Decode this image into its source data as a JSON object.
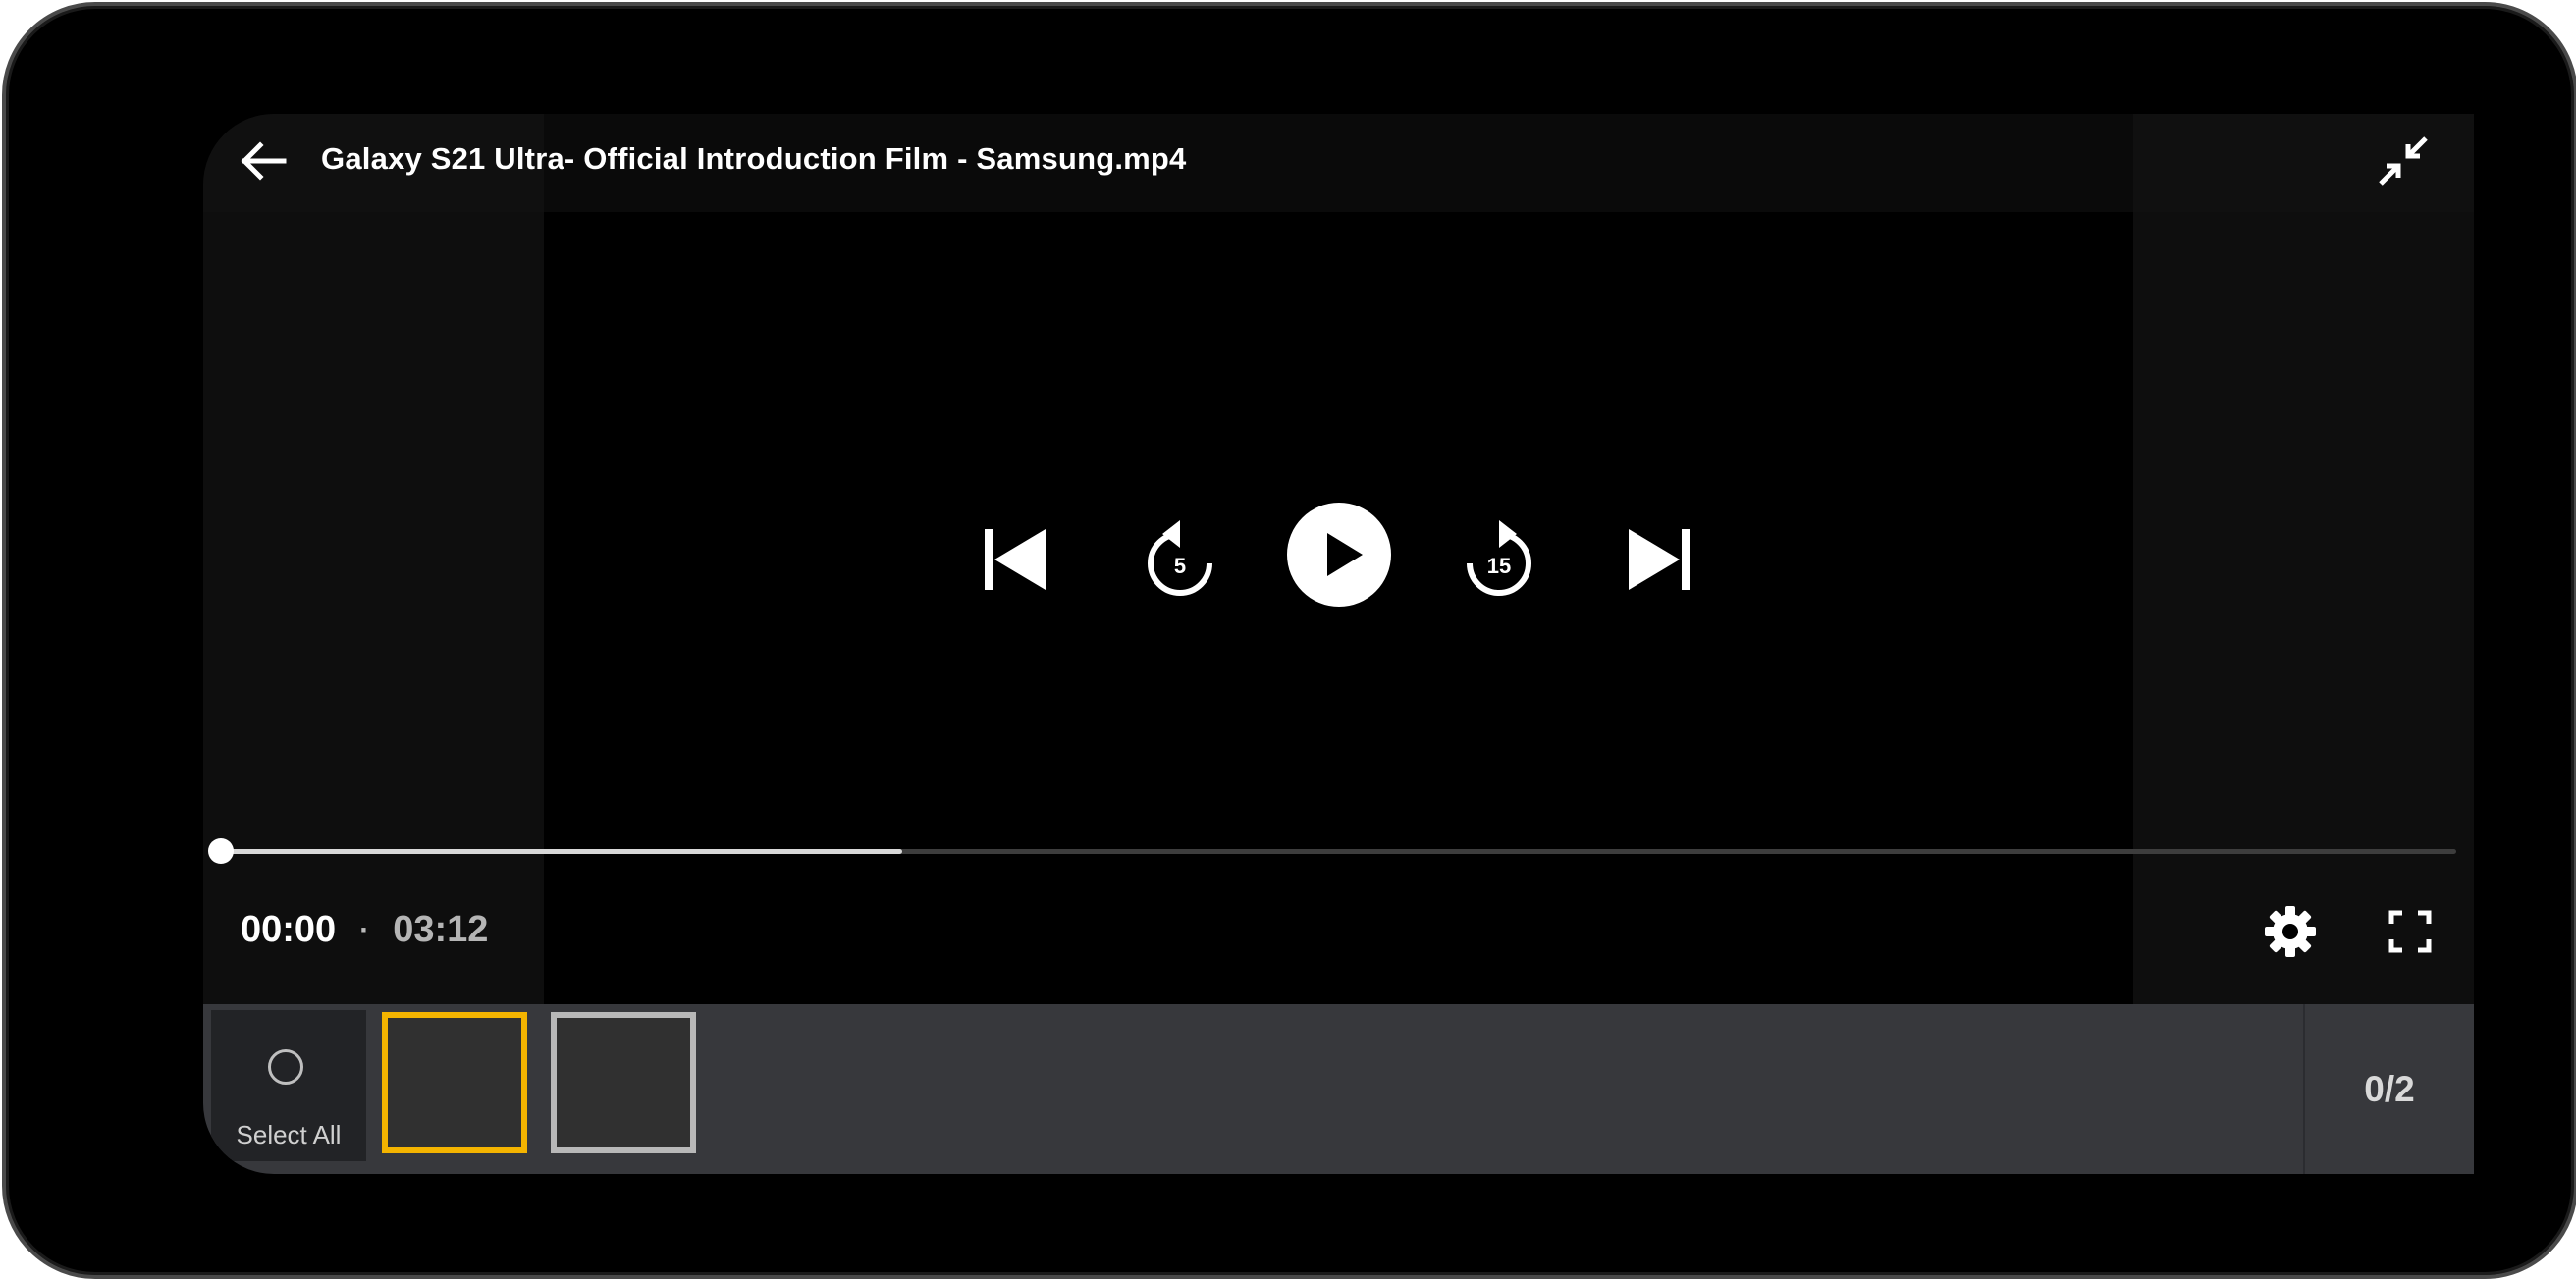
{
  "player": {
    "title": "Galaxy S21 Ultra- Official Introduction Film - Samsung.mp4",
    "time_current": "00:00",
    "time_separator": "·",
    "time_total": "03:12",
    "progress_fraction": 0.0,
    "buffer_fraction": 0.305,
    "rewind_seconds": "5",
    "forward_seconds": "15"
  },
  "icons": {
    "back": "arrow-left",
    "minimize": "exit-fullscreen-arrows",
    "previous": "skip-previous",
    "rewind": "replay-5",
    "play": "play-circle",
    "forward": "forward-15",
    "next": "skip-next",
    "settings": "gear",
    "fullscreen": "fullscreen-corners"
  },
  "selection": {
    "select_all_label": "Select All",
    "counter": "0/2",
    "thumbnails": [
      {
        "state": "focused",
        "border_color": "#f4b400"
      },
      {
        "state": "default",
        "border_color": "#b8b8b8"
      }
    ]
  },
  "colors": {
    "accent_focus": "#f4b400",
    "strip_background": "#37383c",
    "progress_buffer": "#d8d8d8"
  }
}
